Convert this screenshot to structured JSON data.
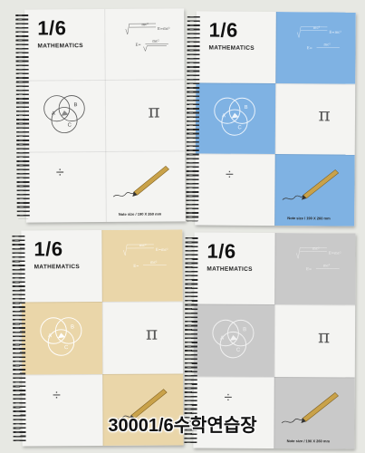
{
  "caption": "30001/6수학연습장",
  "notebooks": [
    {
      "title": "1/6",
      "subtitle": "MATHEMATICS",
      "note": "Note size / 190 X 260 mm",
      "accent": "#f4f4f2",
      "shadow": "#e0e0dc"
    },
    {
      "title": "1/6",
      "subtitle": "MATHEMATICS",
      "note": "Note size / 190 X 260 mm",
      "accent": "#7fb2e3",
      "shadow": "#6a9fd3"
    },
    {
      "title": "1/6",
      "subtitle": "MATHEMATICS",
      "note": "",
      "accent": "#ead6a9",
      "shadow": "#d9c18e"
    },
    {
      "title": "1/6",
      "subtitle": "MATHEMATICS",
      "note": "Note size / 190 X 260 mm",
      "accent": "#c9c9c9",
      "shadow": "#b8b8b8"
    }
  ],
  "formula": {
    "top": "mc²",
    "left": "E=mc²",
    "bottom": "mc²"
  },
  "venn_labels": [
    "A",
    "B",
    "C"
  ],
  "symbols": {
    "pi": "π",
    "divide": "÷"
  }
}
